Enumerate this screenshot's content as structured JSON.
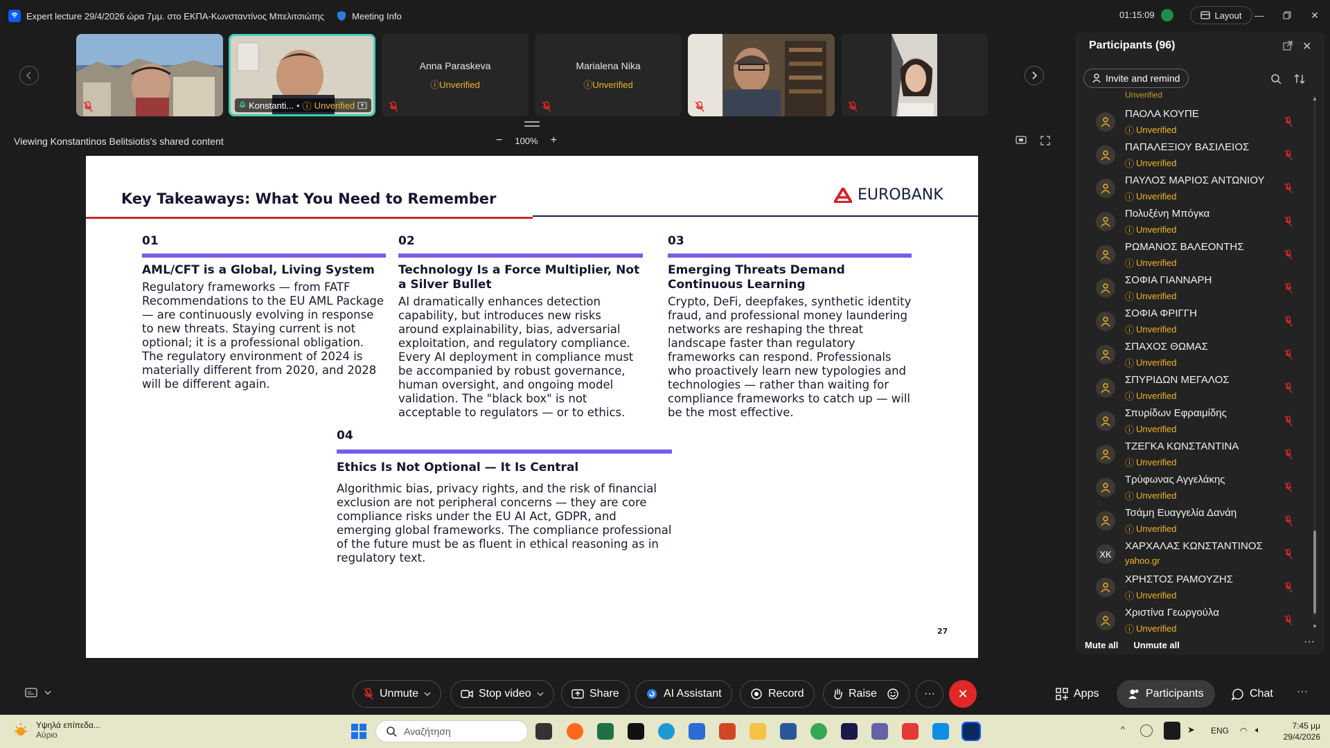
{
  "window": {
    "title": "Expert lecture 29/4/2026 ώρα 7μμ. στο ΕΚΠΑ-Κωνσταντίνος Μπελιτσιώτης",
    "meeting_info": "Meeting Info",
    "timer": "01:15:09",
    "layout_label": "Layout"
  },
  "video_strip": {
    "tiles": [
      {
        "name": "",
        "status": "",
        "kind": "video-city"
      },
      {
        "name": "Konstanti...",
        "status": "Unverified",
        "kind": "video-speaker"
      },
      {
        "name": "Anna Paraskeva",
        "status": "Unverified",
        "kind": "name-only"
      },
      {
        "name": "Marialena Nika",
        "status": "Unverified",
        "kind": "name-only"
      },
      {
        "name": "",
        "status": "",
        "kind": "video-bookshelf"
      },
      {
        "name": "",
        "status": "",
        "kind": "video-woman"
      }
    ]
  },
  "share_bar": {
    "viewing_text": "Viewing Konstantinos Belitsiotis's shared content",
    "zoom": "100%",
    "zoom_minus": "−",
    "zoom_plus": "+"
  },
  "slide": {
    "title": "Key Takeaways: What You Need to Remember",
    "logo_text": "EUROBANK",
    "page_number": "27",
    "columns": [
      {
        "num": "01",
        "heading": "AML/CFT is a Global, Living System",
        "body": "Regulatory frameworks — from FATF Recommendations to the EU AML Package — are continuously evolving in response to new threats. Staying current is not optional; it is a professional obligation. The regulatory environment of 2024 is materially different from 2020, and 2028 will be different again."
      },
      {
        "num": "02",
        "heading": "Technology Is a Force Multiplier, Not a Silver Bullet",
        "body": "AI dramatically enhances detection capability, but introduces new risks around explainability, bias, adversarial exploitation, and regulatory compliance. Every AI deployment in compliance must be accompanied by robust governance, human oversight, and ongoing model validation. The \"black box\" is not acceptable to regulators — or to ethics."
      },
      {
        "num": "03",
        "heading": "Emerging Threats Demand Continuous Learning",
        "body": "Crypto, DeFi, deepfakes, synthetic identity fraud, and professional money laundering networks are reshaping the threat landscape faster than regulatory frameworks can respond. Professionals who proactively learn new typologies and technologies — rather than waiting for compliance frameworks to catch up — will be the most effective."
      },
      {
        "num": "04",
        "heading": "Ethics Is Not Optional — It Is Central",
        "body": "Algorithmic bias, privacy rights, and the risk of financial exclusion are not peripheral concerns — they are core compliance risks under the EU AI Act, GDPR, and emerging global frameworks. The compliance professional of the future must be as fluent in ethical reasoning as in regulatory text."
      }
    ]
  },
  "participants": {
    "title": "Participants (96)",
    "invite_label": "Invite and remind",
    "partial_top": "Unverified",
    "list": [
      {
        "name": "ΠΑΟΛΑ ΚΟΥΠΕ",
        "status": "Unverified",
        "initials": ""
      },
      {
        "name": "ΠΑΠΑΛΕΞΙΟΥ ΒΑΣΙΛΕΙΟΣ",
        "status": "Unverified",
        "initials": ""
      },
      {
        "name": "ΠΑΥΛΟΣ ΜΑΡΙΟΣ ΑΝΤΩΝΙΟΥ",
        "status": "Unverified",
        "initials": ""
      },
      {
        "name": "Πολυξένη Μπόγκα",
        "status": "Unverified",
        "initials": ""
      },
      {
        "name": "ΡΩΜΑΝΟΣ ΒΑΛΕΟΝΤΗΣ",
        "status": "Unverified",
        "initials": ""
      },
      {
        "name": "ΣΟΦΙΑ ΓΙΑΝΝΑΡΗ",
        "status": "Unverified",
        "initials": ""
      },
      {
        "name": "ΣΟΦΙΑ ΦΡΙΓΓΗ",
        "status": "Unverified",
        "initials": ""
      },
      {
        "name": "ΣΠΑΧΟΣ ΘΩΜΑΣ",
        "status": "Unverified",
        "initials": ""
      },
      {
        "name": "ΣΠΥΡΙΔΩΝ ΜΕΓΑΛΟΣ",
        "status": "Unverified",
        "initials": ""
      },
      {
        "name": "Σπυρίδων Εφραιμίδης",
        "status": "Unverified",
        "initials": ""
      },
      {
        "name": "ΤΖΕΓΚΑ ΚΩΝΣΤΑΝΤΙΝΑ",
        "status": "Unverified",
        "initials": ""
      },
      {
        "name": "Τρύφωνας Αγγελάκης",
        "status": "Unverified",
        "initials": ""
      },
      {
        "name": "Τσάμη Ευαγγελία Δανάη",
        "status": "Unverified",
        "initials": ""
      },
      {
        "name": "ΧΑΡΧΑΛΑΣ ΚΩΝΣΤΑΝΤΙΝΟΣ",
        "status": "yahoo.gr",
        "initials": "ΧΚ"
      },
      {
        "name": "ΧΡΗΣΤΟΣ ΡΑΜΟΥΖΗΣ",
        "status": "Unverified",
        "initials": ""
      },
      {
        "name": "Χριστίνα Γεωργούλα",
        "status": "Unverified",
        "initials": ""
      }
    ],
    "mute_all": "Mute all",
    "unmute_all": "Unmute all"
  },
  "toolbar": {
    "unmute": "Unmute",
    "stop_video": "Stop video",
    "share": "Share",
    "ai_assistant": "AI Assistant",
    "record": "Record",
    "raise": "Raise",
    "apps": "Apps",
    "participants": "Participants",
    "chat": "Chat"
  },
  "taskbar": {
    "weather_line1": "Υψηλά επίπεδα...",
    "weather_line2": "Αύριο",
    "search_placeholder": "Αναζήτηση",
    "lang": "ENG",
    "time": "7:45 μμ",
    "date": "29/4/2026"
  },
  "colors": {
    "accent_purple": "#7b5ce6",
    "eurobank_red": "#d3232a",
    "unverified": "#f0b429",
    "end_red": "#e02828"
  }
}
